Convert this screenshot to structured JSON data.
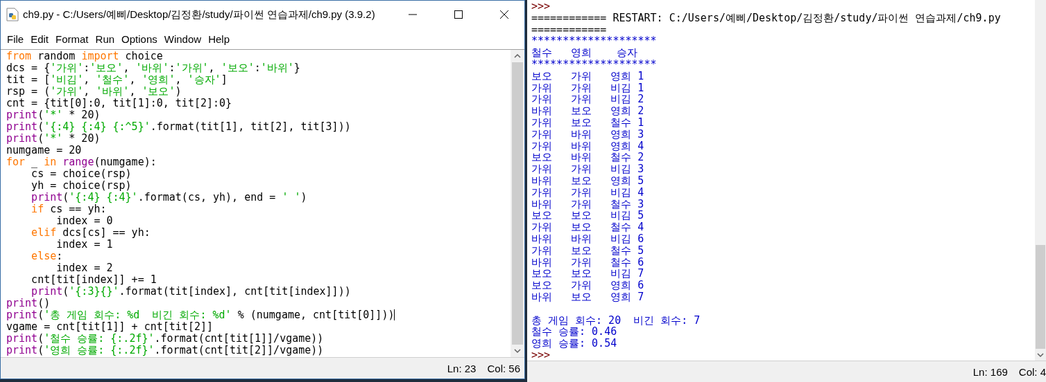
{
  "editor": {
    "title": "ch9.py - C:/Users/예삐/Desktop/김정환/study/파이썬 연습과제/ch9.py (3.9.2)",
    "menu": [
      "File",
      "Edit",
      "Format",
      "Run",
      "Options",
      "Window",
      "Help"
    ],
    "code_lines": [
      {
        "segments": [
          {
            "kind": "keyword",
            "text": "from"
          },
          {
            "kind": "plain",
            "text": " random "
          },
          {
            "kind": "keyword",
            "text": "import"
          },
          {
            "kind": "plain",
            "text": " choice"
          }
        ]
      },
      {
        "segments": [
          {
            "kind": "plain",
            "text": "dcs = {"
          },
          {
            "kind": "string",
            "text": "'가위'"
          },
          {
            "kind": "plain",
            "text": ":"
          },
          {
            "kind": "string",
            "text": "'보오'"
          },
          {
            "kind": "plain",
            "text": ", "
          },
          {
            "kind": "string",
            "text": "'바위'"
          },
          {
            "kind": "plain",
            "text": ":"
          },
          {
            "kind": "string",
            "text": "'가위'"
          },
          {
            "kind": "plain",
            "text": ", "
          },
          {
            "kind": "string",
            "text": "'보오'"
          },
          {
            "kind": "plain",
            "text": ":"
          },
          {
            "kind": "string",
            "text": "'바위'"
          },
          {
            "kind": "plain",
            "text": "}"
          }
        ]
      },
      {
        "segments": [
          {
            "kind": "plain",
            "text": "tit = ["
          },
          {
            "kind": "string",
            "text": "'비김'"
          },
          {
            "kind": "plain",
            "text": ", "
          },
          {
            "kind": "string",
            "text": "'철수'"
          },
          {
            "kind": "plain",
            "text": ", "
          },
          {
            "kind": "string",
            "text": "'영희'"
          },
          {
            "kind": "plain",
            "text": ", "
          },
          {
            "kind": "string",
            "text": "'승자'"
          },
          {
            "kind": "plain",
            "text": "]"
          }
        ]
      },
      {
        "segments": [
          {
            "kind": "plain",
            "text": "rsp = ("
          },
          {
            "kind": "string",
            "text": "'가위'"
          },
          {
            "kind": "plain",
            "text": ", "
          },
          {
            "kind": "string",
            "text": "'바위'"
          },
          {
            "kind": "plain",
            "text": ", "
          },
          {
            "kind": "string",
            "text": "'보오'"
          },
          {
            "kind": "plain",
            "text": ")"
          }
        ]
      },
      {
        "segments": [
          {
            "kind": "plain",
            "text": "cnt = {tit[0]:0, tit[1]:0, tit[2]:0}"
          }
        ]
      },
      {
        "segments": [
          {
            "kind": "builtin",
            "text": "print"
          },
          {
            "kind": "plain",
            "text": "("
          },
          {
            "kind": "string",
            "text": "'*'"
          },
          {
            "kind": "plain",
            "text": " * 20)"
          }
        ]
      },
      {
        "segments": [
          {
            "kind": "builtin",
            "text": "print"
          },
          {
            "kind": "plain",
            "text": "("
          },
          {
            "kind": "string",
            "text": "'{:4} {:4} {:^5}'"
          },
          {
            "kind": "plain",
            "text": ".format(tit[1], tit[2], tit[3]))"
          }
        ]
      },
      {
        "segments": [
          {
            "kind": "builtin",
            "text": "print"
          },
          {
            "kind": "plain",
            "text": "("
          },
          {
            "kind": "string",
            "text": "'*'"
          },
          {
            "kind": "plain",
            "text": " * 20)"
          }
        ]
      },
      {
        "segments": [
          {
            "kind": "plain",
            "text": "numgame = 20"
          }
        ]
      },
      {
        "segments": [
          {
            "kind": "keyword",
            "text": "for"
          },
          {
            "kind": "plain",
            "text": " _ "
          },
          {
            "kind": "keyword",
            "text": "in"
          },
          {
            "kind": "builtin",
            "text": " range"
          },
          {
            "kind": "plain",
            "text": "(numgame):"
          }
        ]
      },
      {
        "segments": [
          {
            "kind": "plain",
            "text": "    cs = choice(rsp)"
          }
        ]
      },
      {
        "segments": [
          {
            "kind": "plain",
            "text": "    yh = choice(rsp)"
          }
        ]
      },
      {
        "segments": [
          {
            "kind": "builtin",
            "text": "    print"
          },
          {
            "kind": "plain",
            "text": "("
          },
          {
            "kind": "string",
            "text": "'{:4} {:4}'"
          },
          {
            "kind": "plain",
            "text": ".format(cs, yh), end = "
          },
          {
            "kind": "string",
            "text": "' '"
          },
          {
            "kind": "plain",
            "text": ")"
          }
        ]
      },
      {
        "segments": [
          {
            "kind": "keyword",
            "text": "    if"
          },
          {
            "kind": "plain",
            "text": " cs == yh:"
          }
        ]
      },
      {
        "segments": [
          {
            "kind": "plain",
            "text": "        index = 0"
          }
        ]
      },
      {
        "segments": [
          {
            "kind": "keyword",
            "text": "    elif"
          },
          {
            "kind": "plain",
            "text": " dcs[cs] == yh:"
          }
        ]
      },
      {
        "segments": [
          {
            "kind": "plain",
            "text": "        index = 1"
          }
        ]
      },
      {
        "segments": [
          {
            "kind": "keyword",
            "text": "    else"
          },
          {
            "kind": "plain",
            "text": ":"
          }
        ]
      },
      {
        "segments": [
          {
            "kind": "plain",
            "text": "        index = 2"
          }
        ]
      },
      {
        "segments": [
          {
            "kind": "plain",
            "text": "    cnt[tit[index]] += 1"
          }
        ]
      },
      {
        "segments": [
          {
            "kind": "builtin",
            "text": "    print"
          },
          {
            "kind": "plain",
            "text": "("
          },
          {
            "kind": "string",
            "text": "'{:3}{}'"
          },
          {
            "kind": "plain",
            "text": ".format(tit[index], cnt[tit[index]]))"
          }
        ]
      },
      {
        "segments": [
          {
            "kind": "builtin",
            "text": "print"
          },
          {
            "kind": "plain",
            "text": "()"
          }
        ]
      },
      {
        "cursor": true,
        "segments": [
          {
            "kind": "builtin",
            "text": "print"
          },
          {
            "kind": "plain",
            "text": "("
          },
          {
            "kind": "string",
            "text": "'총 게임 회수: %d  비긴 회수: %d'"
          },
          {
            "kind": "plain",
            "text": " % (numgame, cnt[tit[0]]))"
          }
        ]
      },
      {
        "segments": [
          {
            "kind": "plain",
            "text": "vgame = cnt[tit[1]] + cnt[tit[2]]"
          }
        ]
      },
      {
        "segments": [
          {
            "kind": "builtin",
            "text": "print"
          },
          {
            "kind": "plain",
            "text": "("
          },
          {
            "kind": "string",
            "text": "'철수 승률: {:.2f}'"
          },
          {
            "kind": "plain",
            "text": ".format(cnt[tit[1]]/vgame))"
          }
        ]
      },
      {
        "segments": [
          {
            "kind": "builtin",
            "text": "print"
          },
          {
            "kind": "plain",
            "text": "("
          },
          {
            "kind": "string",
            "text": "'영희 승률: {:.2f}'"
          },
          {
            "kind": "plain",
            "text": ".format(cnt[tit[2]]/vgame))"
          }
        ]
      }
    ],
    "status": {
      "line": "Ln: 23",
      "column": "Col: 56"
    }
  },
  "shell": {
    "lines": [
      {
        "kind": "prompt",
        "text": ">>>"
      },
      {
        "kind": "restart",
        "text": "============ RESTART: C:/Users/예삐/Desktop/김정환/study/파이썬 연습과제/ch9.py"
      },
      {
        "kind": "restart",
        "text": "============"
      },
      {
        "kind": "output",
        "text": "********************"
      },
      {
        "kind": "output",
        "text": "철수   영희    승자"
      },
      {
        "kind": "output",
        "text": "********************"
      },
      {
        "kind": "output",
        "text": "보오   가위   영희 1"
      },
      {
        "kind": "output",
        "text": "가위   가위   비김 1"
      },
      {
        "kind": "output",
        "text": "가위   가위   비김 2"
      },
      {
        "kind": "output",
        "text": "바위   보오   영희 2"
      },
      {
        "kind": "output",
        "text": "가위   보오   철수 1"
      },
      {
        "kind": "output",
        "text": "가위   바위   영희 3"
      },
      {
        "kind": "output",
        "text": "가위   바위   영희 4"
      },
      {
        "kind": "output",
        "text": "보오   바위   철수 2"
      },
      {
        "kind": "output",
        "text": "가위   가위   비김 3"
      },
      {
        "kind": "output",
        "text": "바위   보오   영희 5"
      },
      {
        "kind": "output",
        "text": "가위   가위   비김 4"
      },
      {
        "kind": "output",
        "text": "바위   가위   철수 3"
      },
      {
        "kind": "output",
        "text": "보오   보오   비김 5"
      },
      {
        "kind": "output",
        "text": "가위   보오   철수 4"
      },
      {
        "kind": "output",
        "text": "바위   바위   비김 6"
      },
      {
        "kind": "output",
        "text": "가위   보오   철수 5"
      },
      {
        "kind": "output",
        "text": "바위   가위   철수 6"
      },
      {
        "kind": "output",
        "text": "보오   보오   비김 7"
      },
      {
        "kind": "output",
        "text": "보오   가위   영희 6"
      },
      {
        "kind": "output",
        "text": "바위   보오   영희 7"
      },
      {
        "kind": "blank"
      },
      {
        "kind": "output",
        "text": "총 게임 회수: 20  비긴 회수: 7"
      },
      {
        "kind": "output",
        "text": "철수 승률: 0.46"
      },
      {
        "kind": "output",
        "text": "영희 승률: 0.54"
      },
      {
        "kind": "prompt",
        "text": ">>>"
      }
    ],
    "status": {
      "line": "Ln: 169",
      "column": "Col: 4"
    }
  }
}
